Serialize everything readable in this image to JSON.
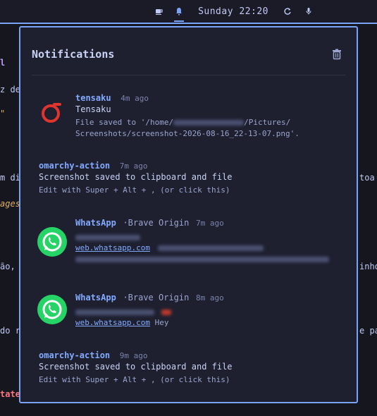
{
  "topbar": {
    "clock": "Sunday 22:20",
    "icons": [
      "coffee-icon",
      "bell-icon",
      "sync-icon",
      "microphone-icon"
    ]
  },
  "editor": {
    "fragments": [
      "l",
      "z de",
      "\"",
      "m di",
      "toa",
      "ages",
      "ão,",
      "inho",
      "do r",
      "e pa",
      "tate"
    ]
  },
  "panel": {
    "title": "Notifications",
    "notifications": [
      {
        "app": "tensaku",
        "time": "4m ago",
        "summary": "Tensaku",
        "body_line1_prefix": "File saved to '/home/",
        "body_line1_suffix": "/Pictures/",
        "body_line2": "Screenshots/screenshot-2026-08-16_22-13-07.png'."
      },
      {
        "app": "omarchy-action",
        "time": "7m ago",
        "summary": "Screenshot saved to clipboard and file",
        "body": "Edit with Super + Alt + , (or click this)"
      },
      {
        "app": "WhatsApp",
        "sub": "·Brave Origin",
        "time": "7m ago",
        "link": "web.whatsapp.com"
      },
      {
        "app": "WhatsApp",
        "sub": "·Brave Origin",
        "time": "8m ago",
        "link": "web.whatsapp.com",
        "message": "Hey"
      },
      {
        "app": "omarchy-action",
        "time": "9m ago",
        "summary": "Screenshot saved to clipboard and file",
        "body": "Edit with Super + Alt + , (or click this)"
      }
    ]
  },
  "colors": {
    "accent": "#7aa2f7",
    "panel_bg": "#1e2030",
    "tensaku_red": "#e0342f",
    "whatsapp_green": "#25d366"
  }
}
